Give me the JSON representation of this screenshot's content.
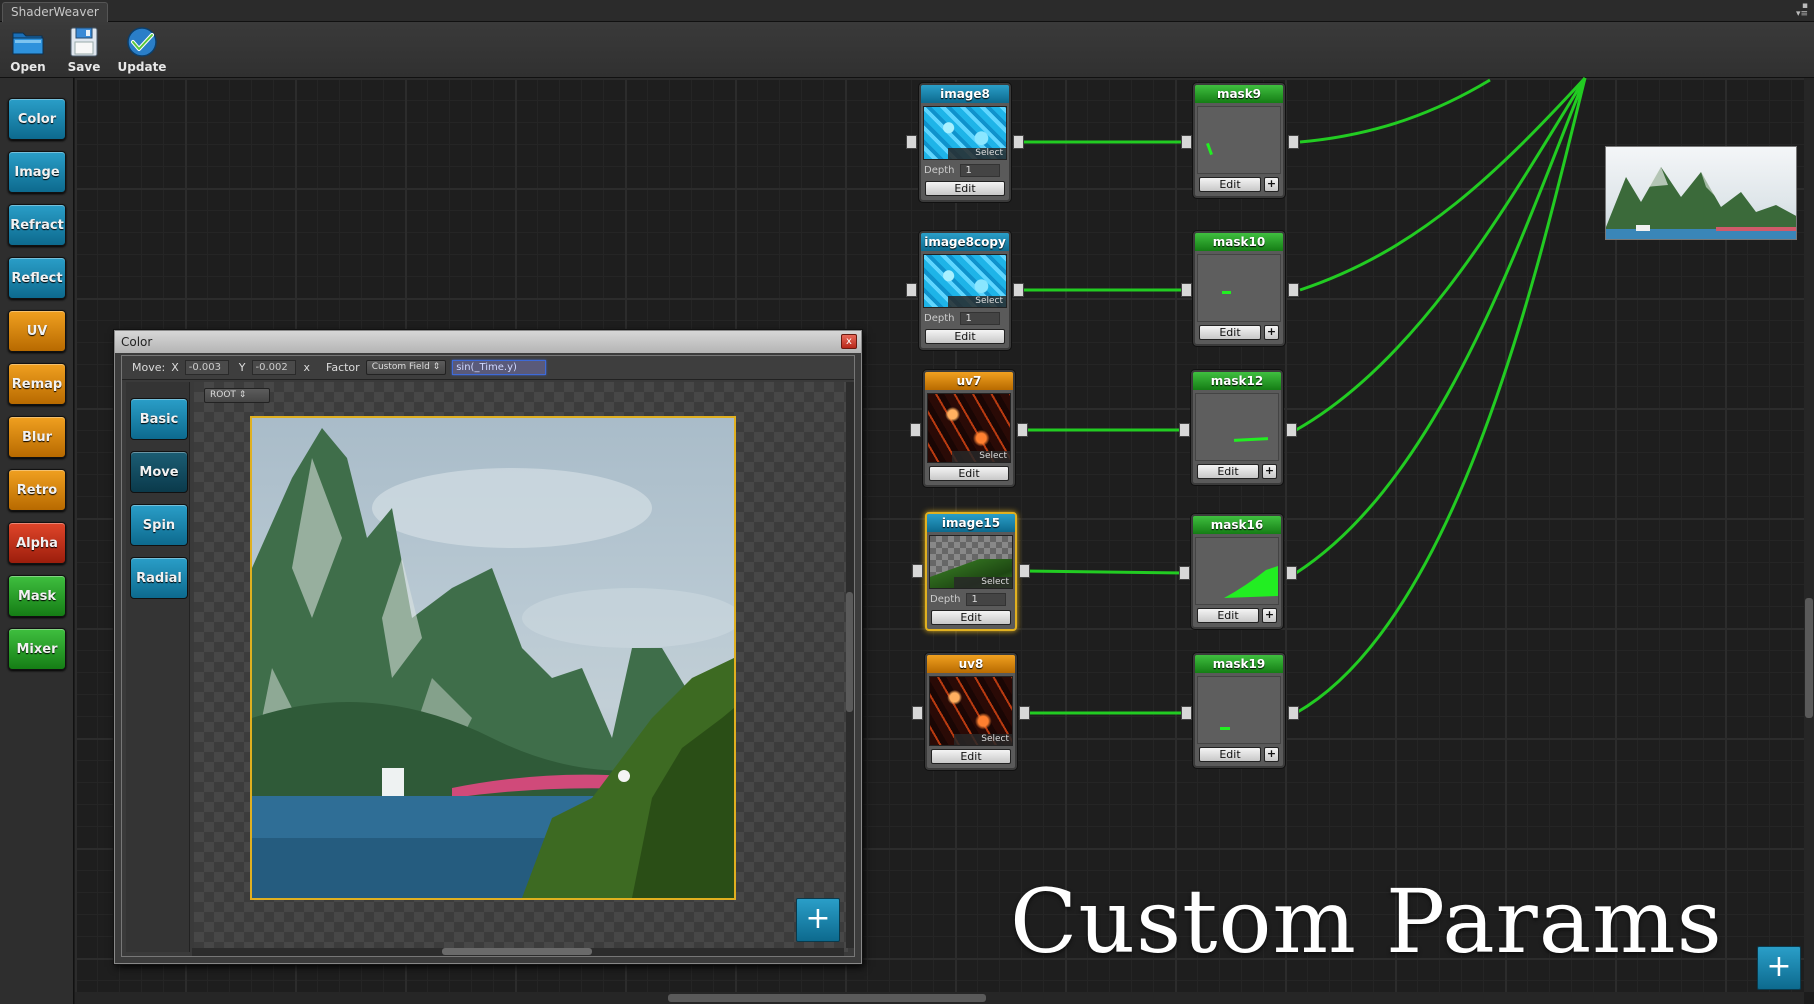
{
  "app": {
    "title": "ShaderWeaver"
  },
  "toolbar": {
    "open_label": "Open",
    "save_label": "Save",
    "update_label": "Update"
  },
  "palette": [
    {
      "label": "Color",
      "color": "blue"
    },
    {
      "label": "Image",
      "color": "blue"
    },
    {
      "label": "Refract",
      "color": "blue"
    },
    {
      "label": "Reflect",
      "color": "blue"
    },
    {
      "label": "UV",
      "color": "orange"
    },
    {
      "label": "Remap",
      "color": "orange"
    },
    {
      "label": "Blur",
      "color": "orange"
    },
    {
      "label": "Retro",
      "color": "orange"
    },
    {
      "label": "Alpha",
      "color": "red"
    },
    {
      "label": "Mask",
      "color": "green"
    },
    {
      "label": "Mixer",
      "color": "green"
    }
  ],
  "nodes": {
    "image8": {
      "title": "image8",
      "select_label": "Select",
      "depth_label": "Depth",
      "depth": "1",
      "edit_label": "Edit"
    },
    "image8copy": {
      "title": "image8copy",
      "select_label": "Select",
      "depth_label": "Depth",
      "depth": "1",
      "edit_label": "Edit"
    },
    "uv7": {
      "title": "uv7",
      "select_label": "Select",
      "edit_label": "Edit"
    },
    "image15": {
      "title": "image15",
      "select_label": "Select",
      "depth_label": "Depth",
      "depth": "1",
      "edit_label": "Edit"
    },
    "uv8": {
      "title": "uv8",
      "select_label": "Select",
      "edit_label": "Edit"
    },
    "mask9": {
      "title": "mask9",
      "edit_label": "Edit",
      "plus_label": "+"
    },
    "mask10": {
      "title": "mask10",
      "edit_label": "Edit",
      "plus_label": "+"
    },
    "mask12": {
      "title": "mask12",
      "edit_label": "Edit",
      "plus_label": "+"
    },
    "mask16": {
      "title": "mask16",
      "edit_label": "Edit",
      "plus_label": "+"
    },
    "mask19": {
      "title": "mask19",
      "edit_label": "Edit",
      "plus_label": "+"
    }
  },
  "color_window": {
    "title": "Color",
    "close_label": "x",
    "move_label": "Move:",
    "x_label": "X",
    "x_value": "-0.003",
    "y_label": "Y",
    "y_value": "-0.002",
    "x_mult": "x",
    "factor_label": "Factor",
    "factor_mode": "Custom Field",
    "factor_expr": "sin(_Time.y)",
    "root_option": "ROOT",
    "tabs": [
      "Basic",
      "Move",
      "Spin",
      "Radial"
    ],
    "active_tab": "Move",
    "plus_label": "+"
  },
  "watermark": "Custom Params",
  "main_plus_label": "+",
  "colors": {
    "wire": "#22cc22",
    "accent_blue": "#1a8ab2",
    "accent_orange": "#e08a10",
    "selected_outline": "#e0b020"
  }
}
